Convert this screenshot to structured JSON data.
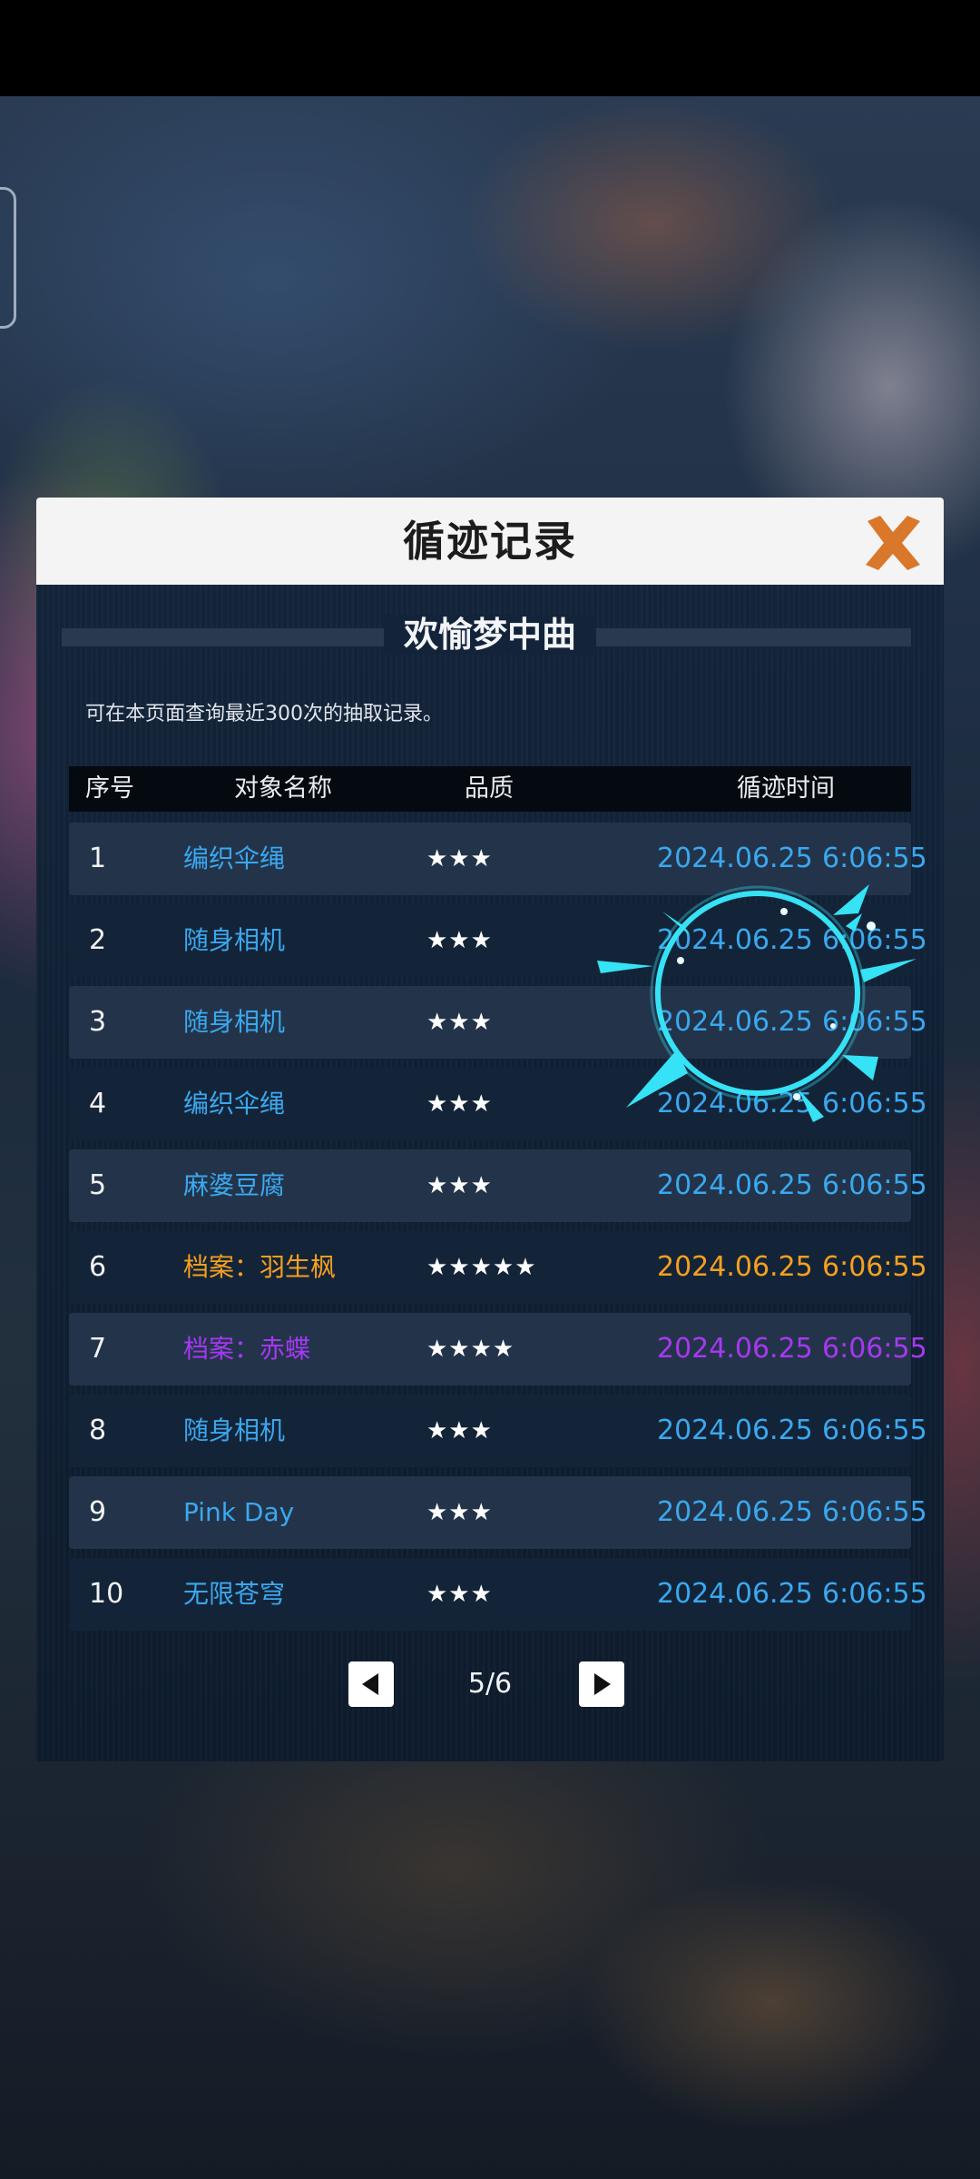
{
  "dialog": {
    "title": "循迹记录",
    "pool_name": "欢愉梦中曲",
    "notice": "可在本页面查询最近300次的抽取记录。"
  },
  "table": {
    "headers": {
      "index": "序号",
      "name": "对象名称",
      "quality": "品质",
      "time": "循迹时间"
    },
    "rows": [
      {
        "index": "1",
        "name": "编织伞绳",
        "stars": "★★★",
        "date": "2024.06.25",
        "time": "6:06:55",
        "color": "#3aa8f0"
      },
      {
        "index": "2",
        "name": "随身相机",
        "stars": "★★★",
        "date": "2024.06.25",
        "time": "6:06:55",
        "color": "#3aa8f0"
      },
      {
        "index": "3",
        "name": "随身相机",
        "stars": "★★★",
        "date": "2024.06.25",
        "time": "6:06:55",
        "color": "#3aa8f0"
      },
      {
        "index": "4",
        "name": "编织伞绳",
        "stars": "★★★",
        "date": "2024.06.25",
        "time": "6:06:55",
        "color": "#3aa8f0"
      },
      {
        "index": "5",
        "name": "麻婆豆腐",
        "stars": "★★★",
        "date": "2024.06.25",
        "time": "6:06:55",
        "color": "#3aa8f0"
      },
      {
        "index": "6",
        "name": "档案：羽生枫",
        "stars": "★★★★★",
        "date": "2024.06.25",
        "time": "6:06:55",
        "color": "#f5a020"
      },
      {
        "index": "7",
        "name": "档案：赤蝶",
        "stars": "★★★★",
        "date": "2024.06.25",
        "time": "6:06:55",
        "color": "#a638f2"
      },
      {
        "index": "8",
        "name": "随身相机",
        "stars": "★★★",
        "date": "2024.06.25",
        "time": "6:06:55",
        "color": "#3aa8f0"
      },
      {
        "index": "9",
        "name": "Pink Day",
        "stars": "★★★",
        "date": "2024.06.25",
        "time": "6:06:55",
        "color": "#3aa8f0"
      },
      {
        "index": "10",
        "name": "无限苍穹",
        "stars": "★★★",
        "date": "2024.06.25",
        "time": "6:06:55",
        "color": "#3aa8f0"
      }
    ]
  },
  "pagination": {
    "current_page": 5,
    "total_pages": 6,
    "label": "5/6"
  },
  "icons": {
    "close": "close-x-icon",
    "prev": "triangle-left-icon",
    "next": "triangle-right-icon",
    "loading": "loading-ring-icon"
  },
  "colors": {
    "rarity_3": "#3aa8f0",
    "rarity_4": "#a638f2",
    "rarity_5": "#f5a020",
    "close_accent": "#d9772a",
    "loader_accent": "#36e2f5"
  }
}
